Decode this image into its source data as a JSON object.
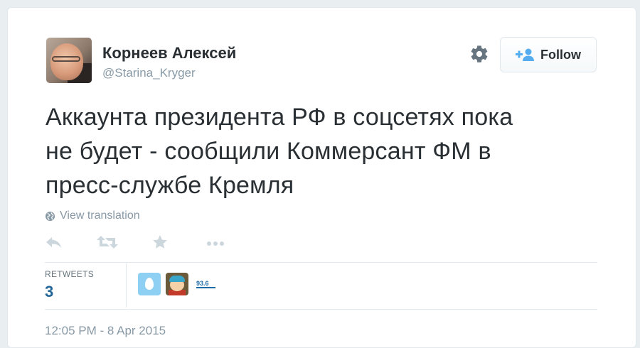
{
  "tweet": {
    "author_name": "Корнеев Алексей",
    "author_handle": "@Starina_Kryger",
    "text_lines": [
      "Аккаунта президента РФ в соцсетях пока",
      "не будет - сообщили Коммерсант ФМ в",
      "пресс-службе Кремля"
    ],
    "view_translation": "View translation",
    "retweets_label": "RETWEETS",
    "retweets_count": "3",
    "timestamp": "12:05 PM - 8 Apr 2015"
  },
  "header": {
    "follow_label": "Follow",
    "settings_icon": "gear-icon",
    "follow_icon": "add-user-icon"
  },
  "actions": {
    "icons": [
      "reply-icon",
      "retweet-icon",
      "favorite-star-icon",
      "more-dots-icon"
    ]
  },
  "retweeters": {
    "avatars": [
      "default-egg-avatar",
      "cartoon-avatar",
      "radio-logo-avatar"
    ],
    "radio_logo_text": "93.6"
  },
  "colors": {
    "background": "#e9eef1",
    "card": "#ffffff",
    "text": "#292f33",
    "muted": "#8899a6",
    "icon": "#ccd6dd",
    "accent": "#226699",
    "follow_icon": "#55acee"
  }
}
